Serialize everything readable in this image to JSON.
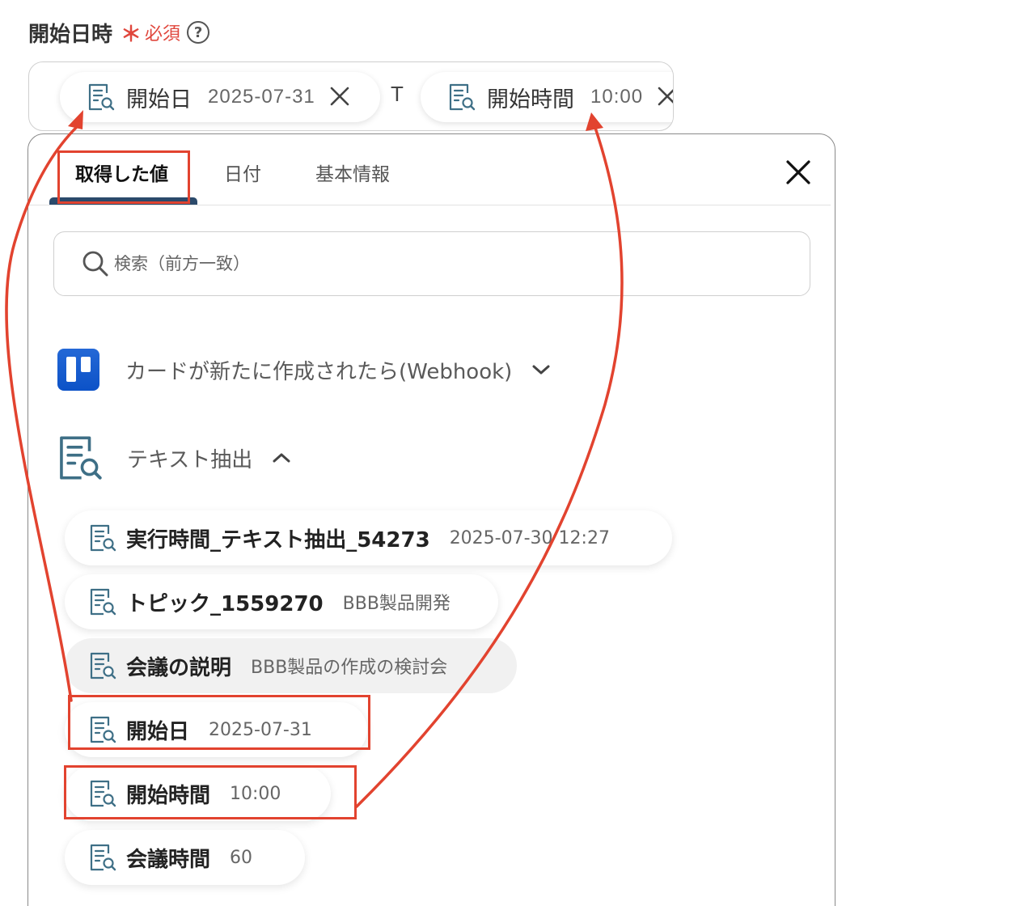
{
  "field": {
    "label": "開始日時",
    "required_mark": "＊",
    "required_text": "必須",
    "help_symbol": "?",
    "chips": [
      {
        "name": "開始日",
        "value": "2025-07-31"
      },
      {
        "name": "開始時間",
        "value": "10:00"
      }
    ],
    "separator": "T"
  },
  "panel": {
    "tabs": [
      {
        "label": "取得した値"
      },
      {
        "label": "日付"
      },
      {
        "label": "基本情報"
      }
    ],
    "active_tab": "取得した値",
    "search": {
      "placeholder": "検索（前方一致）"
    },
    "sections": [
      {
        "title": "カードが新たに作成されたら(Webhook)",
        "expanded": false,
        "icon": "trello-logo"
      },
      {
        "title": "テキスト抽出",
        "expanded": true,
        "icon": "document-search-icon"
      }
    ],
    "items": [
      {
        "name": "実行時間_テキスト抽出_54273",
        "value": "2025-07-30 12:27"
      },
      {
        "name": "トピック_1559270",
        "value": "BBB製品開発"
      },
      {
        "name": "会議の説明",
        "value": "BBB製品の作成の検討会"
      },
      {
        "name": "開始日",
        "value": "2025-07-31"
      },
      {
        "name": "開始時間",
        "value": "10:00"
      },
      {
        "name": "会議時間",
        "value": "60"
      }
    ]
  },
  "colors": {
    "accent": "#2b4a6b",
    "required": "#e0473d",
    "highlight": "#e2432f",
    "trello": "#1d5fd4"
  }
}
